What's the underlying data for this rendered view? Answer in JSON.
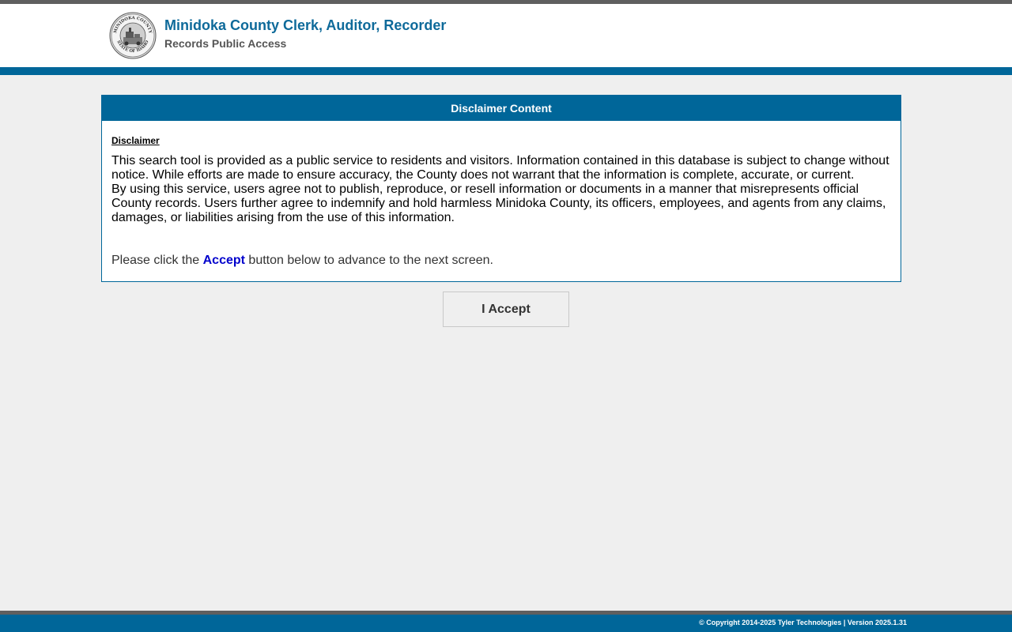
{
  "header": {
    "title": "Minidoka County Clerk, Auditor, Recorder",
    "subtitle": "Records Public Access",
    "seal": {
      "icon": "county-seal-icon",
      "text_top": "MINIDOKA COUNTY",
      "text_bottom": "STATE OF IDAHO"
    }
  },
  "panel": {
    "title": "Disclaimer Content",
    "label": "Disclaimer",
    "paragraph_1": "This search tool is provided as a public service to residents and visitors. Information contained in this database is subject to change without notice. While efforts are made to ensure accuracy, the County does not warrant that the information is complete, accurate, or current.",
    "paragraph_2": "By using this service, users agree not to publish, reproduce, or resell information or documents in a manner that misrepresents official County records. Users further agree to indemnify and hold harmless Minidoka County, its officers, employees, and agents from any claims, damages, or liabilities arising from the use of this information.",
    "click_prefix": "Please click the ",
    "click_accent": "Accept",
    "click_suffix": " button below to advance to the next screen."
  },
  "accept_button": {
    "label": "I Accept"
  },
  "footer": {
    "text": "© Copyright 2014-2025 Tyler Technologies | Version 2025.1.31"
  },
  "colors": {
    "brand_blue": "#006699",
    "title_blue": "#0e6a9a",
    "accent_link": "#0000cc",
    "background": "#efefef",
    "bar_gray": "#5f5f5f"
  }
}
